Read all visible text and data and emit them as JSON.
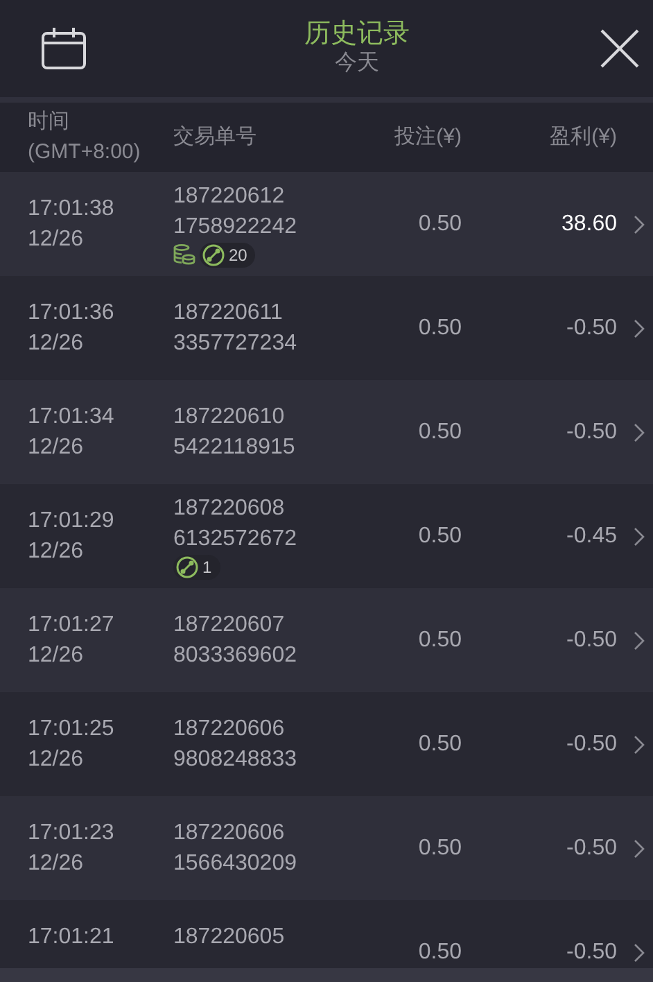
{
  "header": {
    "title": "历史记录",
    "subtitle": "今天"
  },
  "columns": [
    "时间\n(GMT+8:00)",
    "交易单号",
    "投注(¥)",
    "盈利(¥)"
  ],
  "rows": [
    {
      "time": "17:01:38",
      "date": "12/26",
      "order_1": "187220612",
      "order_2": "1758922242",
      "stake": "0.50",
      "profit": "38.60",
      "highlight": true,
      "coins": true,
      "badge": "20"
    },
    {
      "time": "17:01:36",
      "date": "12/26",
      "order_1": "187220611",
      "order_2": "3357727234",
      "stake": "0.50",
      "profit": "-0.50",
      "highlight": false,
      "coins": false
    },
    {
      "time": "17:01:34",
      "date": "12/26",
      "order_1": "187220610",
      "order_2": "5422118915",
      "stake": "0.50",
      "profit": "-0.50",
      "highlight": false,
      "coins": false
    },
    {
      "time": "17:01:29",
      "date": "12/26",
      "order_1": "187220608",
      "order_2": "6132572672",
      "stake": "0.50",
      "profit": "-0.45",
      "highlight": false,
      "coins": false,
      "badge": "1"
    },
    {
      "time": "17:01:27",
      "date": "12/26",
      "order_1": "187220607",
      "order_2": "8033369602",
      "stake": "0.50",
      "profit": "-0.50",
      "highlight": false,
      "coins": false
    },
    {
      "time": "17:01:25",
      "date": "12/26",
      "order_1": "187220606",
      "order_2": "9808248833",
      "stake": "0.50",
      "profit": "-0.50",
      "highlight": false,
      "coins": false
    },
    {
      "time": "17:01:23",
      "date": "12/26",
      "order_1": "187220606",
      "order_2": "1566430209",
      "stake": "0.50",
      "profit": "-0.50",
      "highlight": false,
      "coins": false
    },
    {
      "time": "17:01:21",
      "order_1": "187220605",
      "stake": "0.50",
      "profit": "-0.50",
      "highlight": false,
      "coins": false
    }
  ]
}
